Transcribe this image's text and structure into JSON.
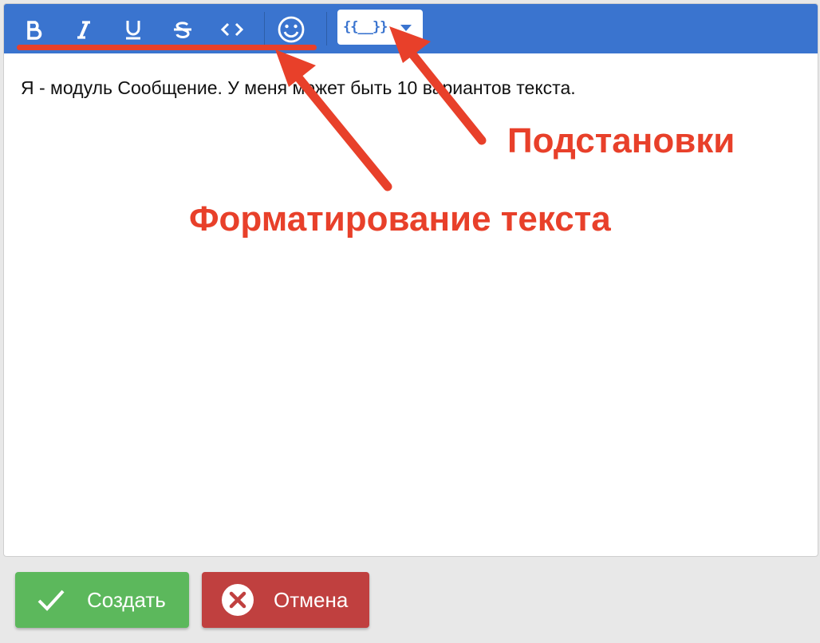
{
  "editor": {
    "message_text": "Я - модуль Сообщение. У меня может быть 10 вариантов текста."
  },
  "toolbar": {
    "buttons": [
      {
        "name": "bold",
        "icon": "bold-icon"
      },
      {
        "name": "italic",
        "icon": "italic-icon"
      },
      {
        "name": "underline",
        "icon": "underline-icon"
      },
      {
        "name": "strikethrough",
        "icon": "strikethrough-icon"
      },
      {
        "name": "code",
        "icon": "code-icon"
      },
      {
        "name": "emoji",
        "icon": "smiley-icon"
      }
    ],
    "substitution_label": "{{__}}"
  },
  "annotations": {
    "substitutions": "Подстановки",
    "formatting": "Форматирование текста"
  },
  "actions": {
    "create_label": "Создать",
    "cancel_label": "Отмена"
  },
  "colors": {
    "toolbar": "#3a74cf",
    "annotation": "#e8402a",
    "create": "#5cb85c",
    "cancel": "#c0403f"
  }
}
